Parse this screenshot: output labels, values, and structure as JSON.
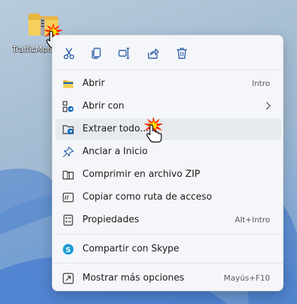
{
  "desktop": {
    "icon_label": "TrafficMon"
  },
  "toolbar": {
    "icons": [
      "scissors-icon",
      "copy-icon",
      "rename-icon",
      "share-icon",
      "trash-icon"
    ]
  },
  "menu": {
    "items": [
      {
        "label": "Abrir",
        "shortcut": "Intro",
        "icon": "folder-icon"
      },
      {
        "label": "Abrir con",
        "shortcut": "",
        "icon": "open-with-icon",
        "submenu": true
      },
      {
        "label": "Extraer todo...",
        "shortcut": "",
        "icon": "extract-icon",
        "hover": true
      },
      {
        "label": "Anclar a Inicio",
        "shortcut": "",
        "icon": "pin-icon"
      },
      {
        "label": "Comprimir en archivo ZIP",
        "shortcut": "",
        "icon": "zip-icon"
      },
      {
        "label": "Copiar como ruta de acceso",
        "shortcut": "",
        "icon": "path-icon"
      },
      {
        "label": "Propiedades",
        "shortcut": "Alt+Intro",
        "icon": "properties-icon"
      },
      {
        "label": "Compartir con Skype",
        "shortcut": "",
        "icon": "skype-icon"
      },
      {
        "label": "Mostrar más opciones",
        "shortcut": "Mayús+F10",
        "icon": "more-options-icon"
      }
    ]
  },
  "colors": {
    "accent": "#0067c0",
    "folder": "#f2c44f",
    "skype": "#1a9bd7",
    "menu_bg": "#f4f6f9"
  }
}
